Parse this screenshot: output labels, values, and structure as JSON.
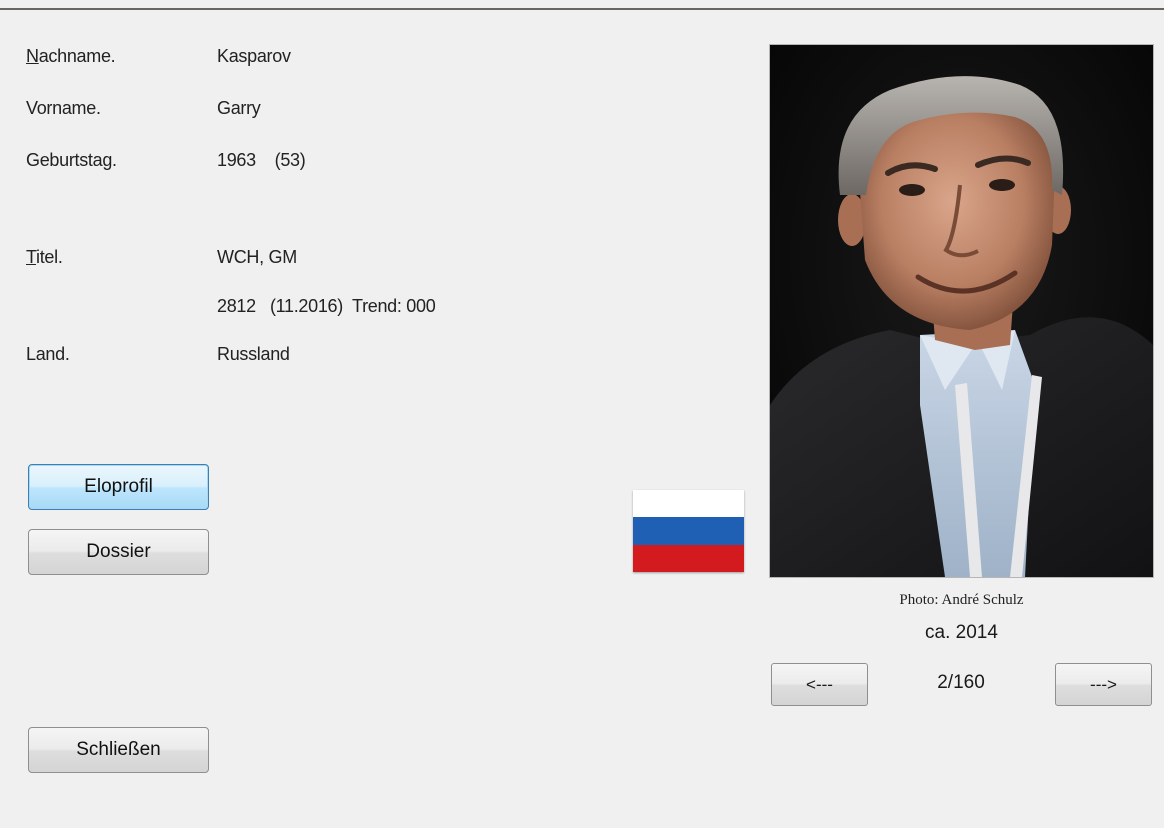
{
  "player": {
    "nachname_label": "Nachname.",
    "nachname_accel": "N",
    "nachname_rest": "achname.",
    "nachname": "Kasparov",
    "vorname_label": "Vorname.",
    "vorname": "Garry",
    "geburtstag_label": "Geburtstag.",
    "geburtstag": "1963    (53)",
    "titel_label": "Titel.",
    "titel_accel": "T",
    "titel_rest": "itel.",
    "titel": "WCH, GM",
    "elo": "2812   (11.2016)  Trend: 000",
    "land_label": "Land.",
    "land": "Russland"
  },
  "buttons": {
    "eloprofil": "Eloprofil",
    "dossier": "Dossier",
    "schliessen": "Schließen"
  },
  "flag": {
    "country": "Russland",
    "colors": [
      "#ffffff",
      "#1f5fb4",
      "#d21a1f"
    ]
  },
  "photo": {
    "credit": "Photo: André Schulz",
    "year": "ca. 2014",
    "prev_label": "<---",
    "next_label": "--->",
    "counter": "2/160"
  }
}
